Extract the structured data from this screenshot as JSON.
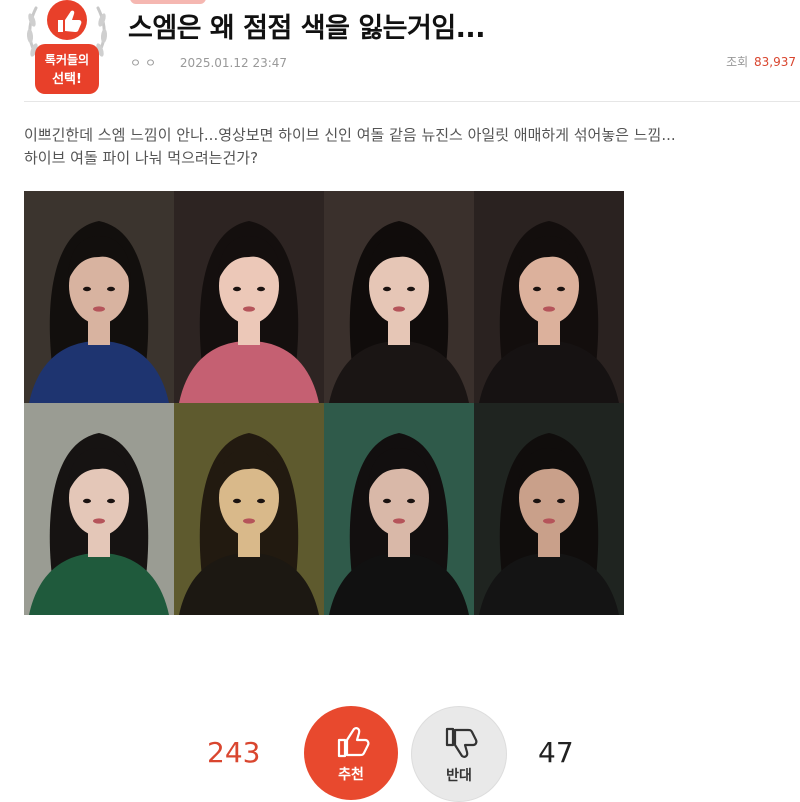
{
  "badge": {
    "line1": "톡커들의",
    "line2": "선택!"
  },
  "post": {
    "title": "스엠은 왜 점점 색을 잃는거임...",
    "author": "ㅇㅇ",
    "date": "2025.01.12 23:47",
    "views_label": "조회",
    "views_count": "83,937",
    "body_line1": "이쁘긴한데 스엠 느낌이 안나...영상보면 하이브 신인 여돌 같음 뉴진스 아일릿 애매하게 섞어놓은 느낌...",
    "body_line2": "하이브 여돌 파이 나눠 먹으려는건가?"
  },
  "photos": [
    {
      "name": "photo-1",
      "bg": "#3b342e",
      "hair": "#120f0d",
      "skin": "#d8b3a0",
      "cloth": "#1e3470"
    },
    {
      "name": "photo-2",
      "bg": "#2d2422",
      "hair": "#140f0e",
      "skin": "#ecc8b8",
      "cloth": "#c56072"
    },
    {
      "name": "photo-3",
      "bg": "#3a302c",
      "hair": "#100c0b",
      "skin": "#e6c6b6",
      "cloth": "#1a1514"
    },
    {
      "name": "photo-4",
      "bg": "#2a2220",
      "hair": "#130e0d",
      "skin": "#dcb19c",
      "cloth": "#161212"
    },
    {
      "name": "photo-5",
      "bg": "#9a9c93",
      "hair": "#161312",
      "skin": "#e4c7b8",
      "cloth": "#1f5a3c"
    },
    {
      "name": "photo-6",
      "bg": "#5e5a2e",
      "hair": "#221a10",
      "skin": "#d9b98a",
      "cloth": "#1c1812"
    },
    {
      "name": "photo-7",
      "bg": "#2f5a4a",
      "hair": "#120f0f",
      "skin": "#d9b8a8",
      "cloth": "#111111"
    },
    {
      "name": "photo-8",
      "bg": "#1f2420",
      "hair": "#100d0c",
      "skin": "#c9a08a",
      "cloth": "#141414"
    }
  ],
  "vote": {
    "up_count": "243",
    "up_label": "추천",
    "down_count": "47",
    "down_label": "반대"
  },
  "colors": {
    "accent": "#e8492e",
    "badge_red": "#e8402a"
  }
}
